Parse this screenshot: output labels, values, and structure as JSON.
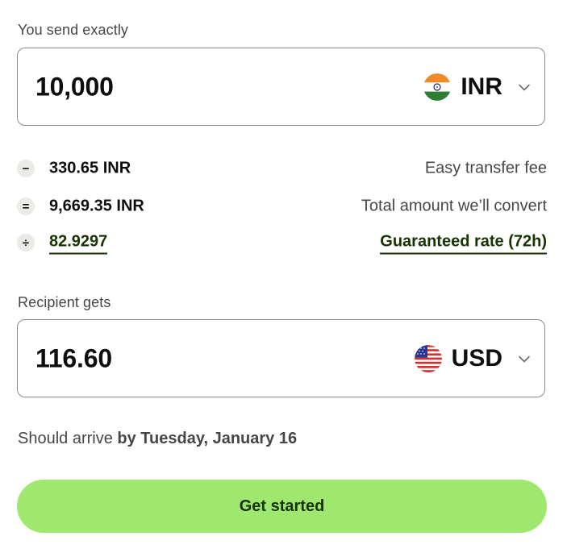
{
  "send": {
    "label": "You send exactly",
    "amount": "10,000",
    "currency": "INR",
    "flag_icon": "india-flag-icon"
  },
  "breakdown": [
    {
      "operator": "−",
      "amount": "330.65 INR",
      "description": "Easy transfer fee"
    },
    {
      "operator": "=",
      "amount": "9,669.35 INR",
      "description": "Total amount we’ll convert"
    },
    {
      "operator": "÷",
      "amount": "82.9297",
      "description": "Guaranteed rate (72h)"
    }
  ],
  "receive": {
    "label": "Recipient gets",
    "amount": "116.60",
    "currency": "USD",
    "flag_icon": "usa-flag-icon"
  },
  "arrival": {
    "prefix": "Should arrive",
    "date": "by Tuesday, January 16"
  },
  "cta": {
    "label": "Get started"
  },
  "colors": {
    "accent": "#9fe870",
    "accent_text": "#163300",
    "border": "#8a8c89",
    "muted_text": "#454745"
  }
}
